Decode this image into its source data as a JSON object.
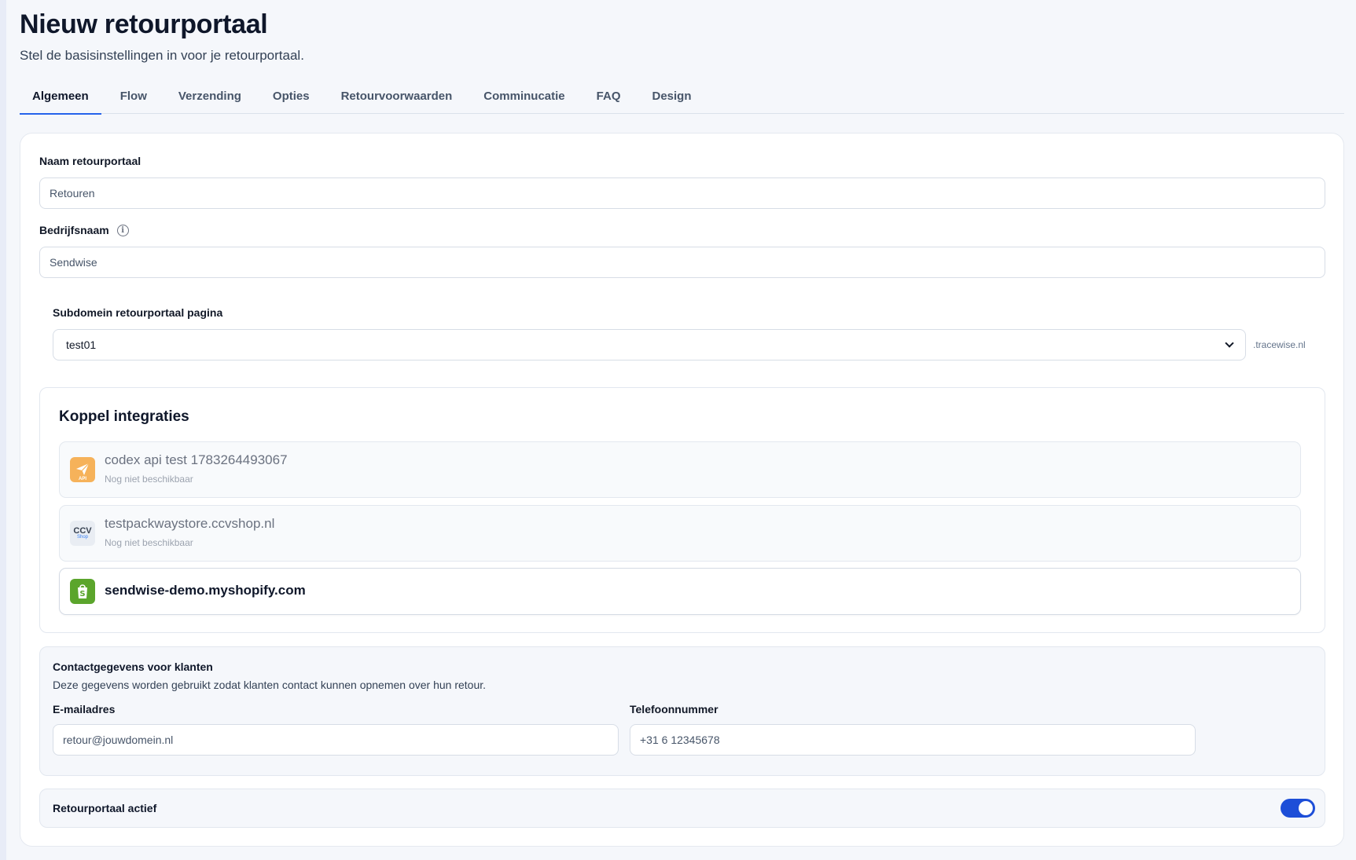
{
  "header": {
    "title": "Nieuw retourportaal",
    "subtitle": "Stel de basisinstellingen in voor je retourportaal."
  },
  "tabs": [
    {
      "label": "Algemeen",
      "active": true
    },
    {
      "label": "Flow",
      "active": false
    },
    {
      "label": "Verzending",
      "active": false
    },
    {
      "label": "Opties",
      "active": false
    },
    {
      "label": "Retourvoorwaarden",
      "active": false
    },
    {
      "label": "Comminucatie",
      "active": false
    },
    {
      "label": "FAQ",
      "active": false
    },
    {
      "label": "Design",
      "active": false
    }
  ],
  "form": {
    "name_label": "Naam retourportaal",
    "name_value": "Retouren",
    "company_label": "Bedrijfsnaam",
    "company_info_icon": "info-icon",
    "company_value": "Sendwise",
    "subdomain_label": "Subdomein retourportaal pagina",
    "subdomain_value": "test01",
    "subdomain_suffix": ".tracewise.nl"
  },
  "integrations": {
    "title": "Koppel integraties",
    "items": [
      {
        "name": "codex api test 1783264493067",
        "status": "Nog niet beschikbaar",
        "icon": "paper-plane-api-icon",
        "logo_text": "API",
        "color": "#f6b25a",
        "enabled": false
      },
      {
        "name": "testpackwaystore.ccvshop.nl",
        "status": "Nog niet beschikbaar",
        "icon": "ccv-shop-logo",
        "logo_text": "CCV",
        "logo_subtext": "Shop",
        "color": "#e9edf3",
        "enabled": false
      },
      {
        "name": "sendwise-demo.myshopify.com",
        "status": "",
        "icon": "shopify-bag-icon",
        "color": "#5ba52c",
        "enabled": true
      }
    ]
  },
  "contact": {
    "title": "Contactgegevens voor klanten",
    "description": "Deze gegevens worden gebruikt zodat klanten contact kunnen opnemen over hun retour.",
    "email_label": "E-mailadres",
    "email_value": "retour@jouwdomein.nl",
    "phone_label": "Telefoonnummer",
    "phone_value": "+31 6 12345678"
  },
  "active": {
    "label": "Retourportaal actief",
    "enabled": true,
    "color": "#1d4ed8"
  },
  "colors": {
    "accent": "#2563eb",
    "background": "#f5f7fb"
  }
}
